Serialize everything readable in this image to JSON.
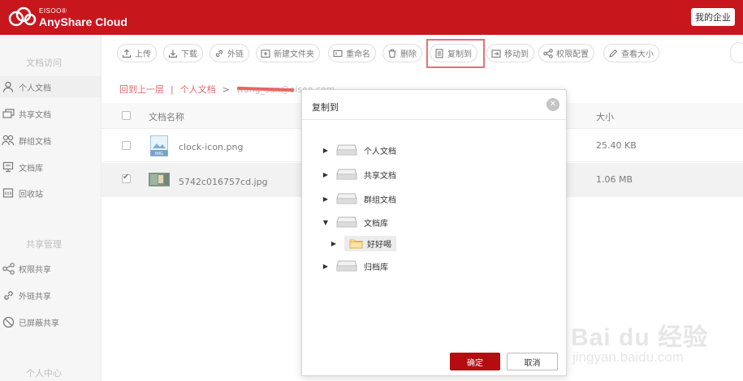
{
  "header": {
    "logo_small": "EISOO®",
    "logo_big": "AnyShare Cloud",
    "enterprise_label": "我的企业"
  },
  "sidebar": {
    "sections": {
      "doc_access": "文档访问",
      "share_mgmt": "共享管理",
      "personal_center": "个人中心"
    },
    "items": [
      {
        "label": "个人文档",
        "icon": "person-icon",
        "active": true
      },
      {
        "label": "共享文档",
        "icon": "share-doc-icon"
      },
      {
        "label": "群组文档",
        "icon": "group-icon"
      },
      {
        "label": "文档库",
        "icon": "library-icon"
      },
      {
        "label": "回收站",
        "icon": "recycle-icon"
      },
      {
        "label": "权限共享",
        "icon": "share-icon"
      },
      {
        "label": "外链共享",
        "icon": "link-icon"
      },
      {
        "label": "已屏蔽共享",
        "icon": "block-icon"
      }
    ]
  },
  "toolbar": {
    "upload": "上传",
    "download": "下载",
    "external_link": "外链",
    "new_folder": "新建文件夹",
    "rename": "重命名",
    "delete": "删除",
    "copy_to": "复制到",
    "move_to": "移动到",
    "permission": "权限配置",
    "view_size": "查看大小"
  },
  "breadcrumb": {
    "back": "回到上一层",
    "current": "个人文档",
    "email": "wang_san@eisoo.com"
  },
  "table": {
    "col_name": "文档名称",
    "col_size": "大小",
    "rows": [
      {
        "name": "clock-icon.png",
        "size": "25.40 KB",
        "checked": false,
        "icon_text": "IMG"
      },
      {
        "name": "5742c016757cd.jpg",
        "size": "1.06 MB",
        "checked": true
      }
    ]
  },
  "modal": {
    "title": "复制到",
    "tree": [
      {
        "label": "个人文档",
        "expanded": false
      },
      {
        "label": "共享文档",
        "expanded": false
      },
      {
        "label": "群组文档",
        "expanded": false
      },
      {
        "label": "文档库",
        "expanded": true,
        "children": [
          {
            "label": "好好喝"
          }
        ]
      },
      {
        "label": "归档库",
        "expanded": false
      }
    ],
    "ok_label": "确定",
    "cancel_label": "取消"
  },
  "watermark": {
    "brand": "Bai du 经验",
    "url": "jingyan.baidu.com"
  },
  "colors": {
    "brand_red": "#c8161d",
    "ok_button": "#b30d12"
  }
}
